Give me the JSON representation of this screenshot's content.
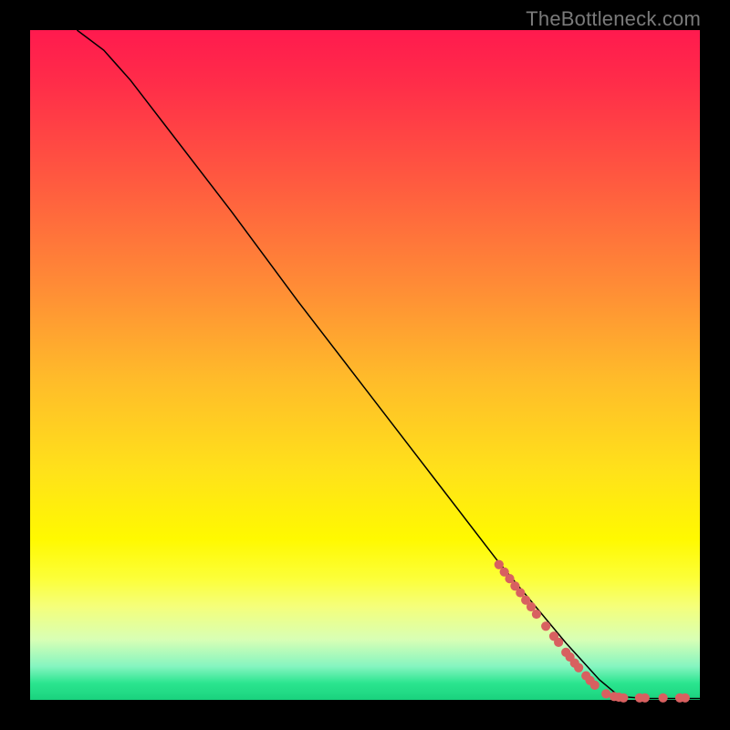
{
  "attribution": "TheBottleneck.com",
  "chart_data": {
    "type": "line",
    "title": "",
    "xlabel": "",
    "ylabel": "",
    "xlim": [
      0,
      100
    ],
    "ylim": [
      0,
      100
    ],
    "grid": false,
    "legend": false,
    "background": "rainbow-gradient",
    "curve": {
      "description": "Monotonically decreasing bottleneck curve from (~7,100) to (~88,0) then flat at 0",
      "points": [
        [
          7,
          100
        ],
        [
          11,
          97
        ],
        [
          15,
          92.5
        ],
        [
          20,
          86
        ],
        [
          30,
          73
        ],
        [
          40,
          59.5
        ],
        [
          50,
          46.5
        ],
        [
          60,
          33.5
        ],
        [
          70,
          20.5
        ],
        [
          80,
          8.5
        ],
        [
          85,
          3
        ],
        [
          88,
          0.5
        ],
        [
          92,
          0.2
        ],
        [
          100,
          0.2
        ]
      ]
    },
    "markers": {
      "description": "Highlighted data points (pink dots/segments) along the lower portion of the curve",
      "points": [
        [
          70.0,
          20.2
        ],
        [
          70.8,
          19.1
        ],
        [
          71.6,
          18.1
        ],
        [
          72.4,
          17.0
        ],
        [
          73.2,
          16.0
        ],
        [
          74.0,
          14.9
        ],
        [
          74.8,
          13.9
        ],
        [
          75.6,
          12.8
        ],
        [
          77.0,
          11.0
        ],
        [
          78.2,
          9.5
        ],
        [
          78.9,
          8.6
        ],
        [
          80.0,
          7.1
        ],
        [
          80.6,
          6.4
        ],
        [
          81.3,
          5.5
        ],
        [
          81.9,
          4.8
        ],
        [
          83.0,
          3.6
        ],
        [
          83.6,
          2.9
        ],
        [
          84.3,
          2.2
        ],
        [
          86.0,
          0.9
        ],
        [
          87.2,
          0.5
        ],
        [
          87.9,
          0.4
        ],
        [
          88.6,
          0.3
        ],
        [
          91.0,
          0.3
        ],
        [
          91.8,
          0.3
        ],
        [
          94.5,
          0.3
        ],
        [
          97.0,
          0.3
        ],
        [
          97.8,
          0.3
        ]
      ],
      "radius": 5.1,
      "color": "#d86060"
    }
  }
}
